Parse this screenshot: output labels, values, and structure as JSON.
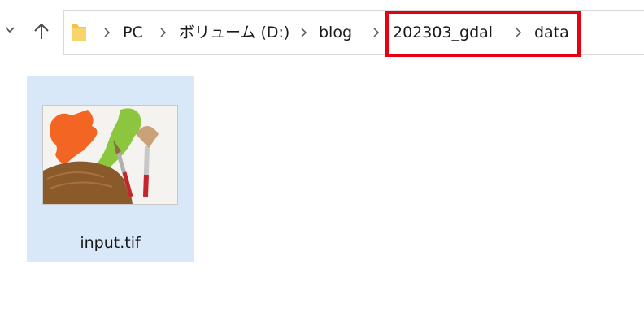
{
  "address_bar": {
    "breadcrumbs": [
      "PC",
      "ボリューム (D:)",
      "blog",
      "202303_gdal",
      "data"
    ]
  },
  "files": [
    {
      "name": "input.tif",
      "icon": "painting-image-icon",
      "selected": true
    }
  ],
  "colors": {
    "selection": "#d9e8f8",
    "highlight": "#e60012",
    "folder": "#f5c342"
  }
}
